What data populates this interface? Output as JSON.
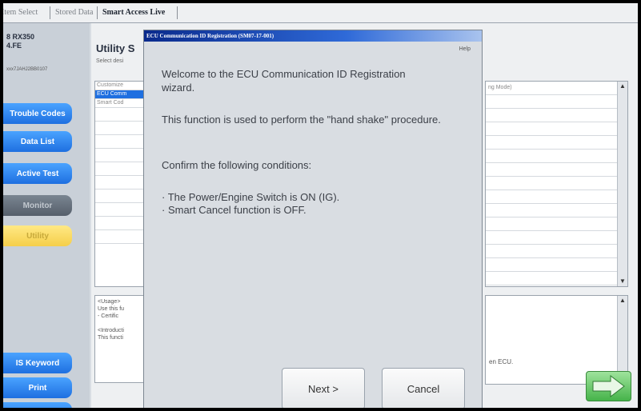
{
  "tabs": [
    "Item Select",
    "Stored Data",
    "Smart Access Live"
  ],
  "vehicle": {
    "model": "8 RX350",
    "line2": "4.FE",
    "vin": "xxx7JAHJ2BB0107"
  },
  "sidebar": {
    "buttons": [
      {
        "label": "Trouble Codes",
        "style": "blue"
      },
      {
        "label": "Data List",
        "style": "blue"
      },
      {
        "label": "Active Test",
        "style": "blue"
      },
      {
        "label": "Monitor",
        "style": "gray"
      },
      {
        "label": "Utility",
        "style": "yellow"
      }
    ],
    "bottom_buttons": [
      {
        "label": "IS Keyword",
        "style": "blue"
      },
      {
        "label": "Print",
        "style": "blue"
      }
    ]
  },
  "main": {
    "title": "Utility S",
    "subtitle": "Select desi",
    "list_items": [
      "Customize",
      "ECU Comm",
      "Smart Cod"
    ],
    "selected_index": 1,
    "usage_lines": [
      "<Usage>",
      "Use this fu",
      " - Certific",
      "",
      "<Introducti",
      "This functi"
    ],
    "right_header": "ng Mode)",
    "right_usage_text": "en ECU."
  },
  "dialog": {
    "title": "ECU Communication ID Registration (SM07-17-001)",
    "help": "Help",
    "welcome": "Welcome to the ECU Communication ID Registration wizard.",
    "purpose": "This function is used to perform the \"hand shake\" procedure.",
    "confirm": "Confirm the following conditions:",
    "condition1": "· The Power/Engine Switch is ON (IG).",
    "condition2": "· Smart Cancel function is OFF.",
    "next_label": "Next >",
    "cancel_label": "Cancel"
  }
}
